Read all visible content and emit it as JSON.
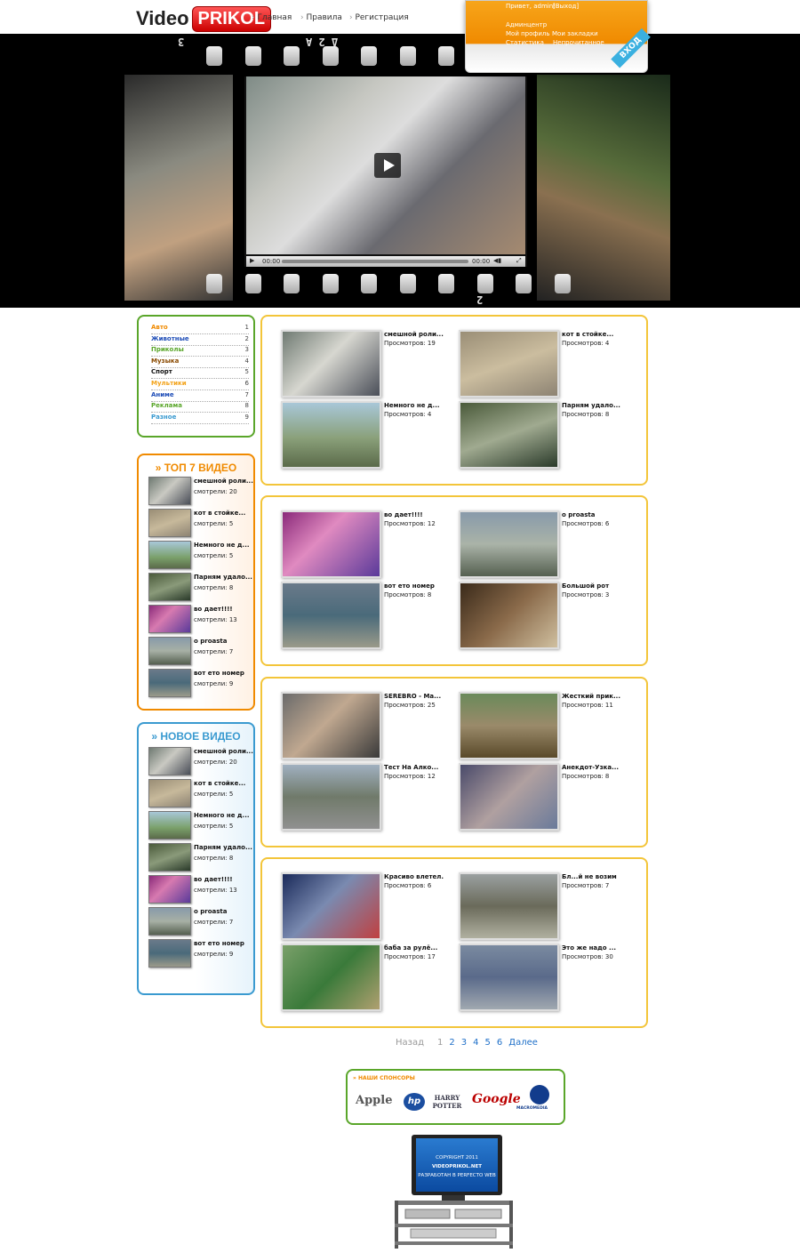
{
  "header": {
    "logo_left": "Video",
    "logo_right": "PRIKOL",
    "nav": [
      "Главная",
      "Правила",
      "Регистрация"
    ],
    "user": {
      "greeting": "Привет, admin!",
      "logout": "[Выход]",
      "links": [
        "Админцентр",
        "Мой профиль",
        "Мои закладки",
        "Статистика",
        "Непрочитанное"
      ],
      "login_tab": "ВХОД"
    }
  },
  "film": {
    "top_digits": "Δ 2 A",
    "top_left_digit": "3",
    "bottom_digit": "2"
  },
  "player": {
    "time_current": "00:00",
    "time_total": "00:00"
  },
  "categories": [
    {
      "label": "Авто",
      "count": "1",
      "color": "#f08a00"
    },
    {
      "label": "Животные",
      "count": "2",
      "color": "#1e4db7"
    },
    {
      "label": "Приколы",
      "count": "3",
      "color": "#5aa62a"
    },
    {
      "label": "Музыка",
      "count": "4",
      "color": "#8a4a00"
    },
    {
      "label": "Спорт",
      "count": "5",
      "color": "#111111"
    },
    {
      "label": "Мультики",
      "count": "6",
      "color": "#f3a31a"
    },
    {
      "label": "Аниме",
      "count": "7",
      "color": "#1e4db7"
    },
    {
      "label": "Реклама",
      "count": "8",
      "color": "#5aa62a"
    },
    {
      "label": "Разное",
      "count": "9",
      "color": "#3a9ad0"
    }
  ],
  "top7": {
    "title": "» ТОП 7 ВИДЕО",
    "items": [
      {
        "title": "смешной роли...",
        "count": "смотрели: 20"
      },
      {
        "title": "кот в стойке...",
        "count": "смотрели: 5"
      },
      {
        "title": "Немного не д...",
        "count": "смотрели: 5"
      },
      {
        "title": "Парням удало...",
        "count": "смотрели: 8"
      },
      {
        "title": "во дает!!!!",
        "count": "смотрели: 13"
      },
      {
        "title": "о proasta",
        "count": "смотрели: 7"
      },
      {
        "title": "вот ето номер",
        "count": "смотрели: 9"
      }
    ]
  },
  "newvid": {
    "title": "» НОВОЕ ВИДЕО",
    "items": [
      {
        "title": "смешной роли...",
        "count": "смотрели: 20"
      },
      {
        "title": "кот в стойке...",
        "count": "смотрели: 5"
      },
      {
        "title": "Немного не д...",
        "count": "смотрели: 5"
      },
      {
        "title": "Парням удало...",
        "count": "смотрели: 8"
      },
      {
        "title": "во дает!!!!",
        "count": "смотрели: 13"
      },
      {
        "title": "о proasta",
        "count": "смотрели: 7"
      },
      {
        "title": "вот ето номер",
        "count": "смотрели: 9"
      }
    ]
  },
  "grid": [
    [
      {
        "title": "смешной роли...",
        "views": "Просмотров: 19"
      },
      {
        "title": "кот в стойке...",
        "views": "Просмотров: 4"
      },
      {
        "title": "Немного не д...",
        "views": "Просмотров: 4"
      },
      {
        "title": "Парням удало...",
        "views": "Просмотров: 8"
      }
    ],
    [
      {
        "title": "во дает!!!!",
        "views": "Просмотров: 12"
      },
      {
        "title": "о proasta",
        "views": "Просмотров: 6"
      },
      {
        "title": "вот ето номер",
        "views": "Просмотров: 8"
      },
      {
        "title": "Большой рот",
        "views": "Просмотров: 3"
      }
    ],
    [
      {
        "title": "SEREBRO - Ма...",
        "views": "Просмотров: 25"
      },
      {
        "title": "Жесткий прик...",
        "views": "Просмотров: 11"
      },
      {
        "title": "Тест На Алко...",
        "views": "Просмотров: 12"
      },
      {
        "title": "Анекдот-Узка...",
        "views": "Просмотров: 8"
      }
    ],
    [
      {
        "title": "Красиво влетел.",
        "views": "Просмотров: 6"
      },
      {
        "title": "Бл...й не возим",
        "views": "Просмотров: 7"
      },
      {
        "title": "баба за рулё...",
        "views": "Просмотров: 17"
      },
      {
        "title": "Это же надо ...",
        "views": "Просмотров: 30"
      }
    ]
  ],
  "pager": {
    "prev": "Назад",
    "pages": [
      "1",
      "2",
      "3",
      "4",
      "5",
      "6"
    ],
    "next": "Далее"
  },
  "sponsors": {
    "title": "» НАШИ СПОНСОРЫ",
    "brands": [
      "Apple",
      "hp",
      "HARRY POTTER",
      "Google",
      "MACROMEDIA"
    ]
  },
  "footer": {
    "line1": "COPYRIGHT 2011",
    "line2": "VIDEOPRIKOL.NET",
    "line3": "РАЗРАБОТАН В PERFECTO WEB"
  }
}
